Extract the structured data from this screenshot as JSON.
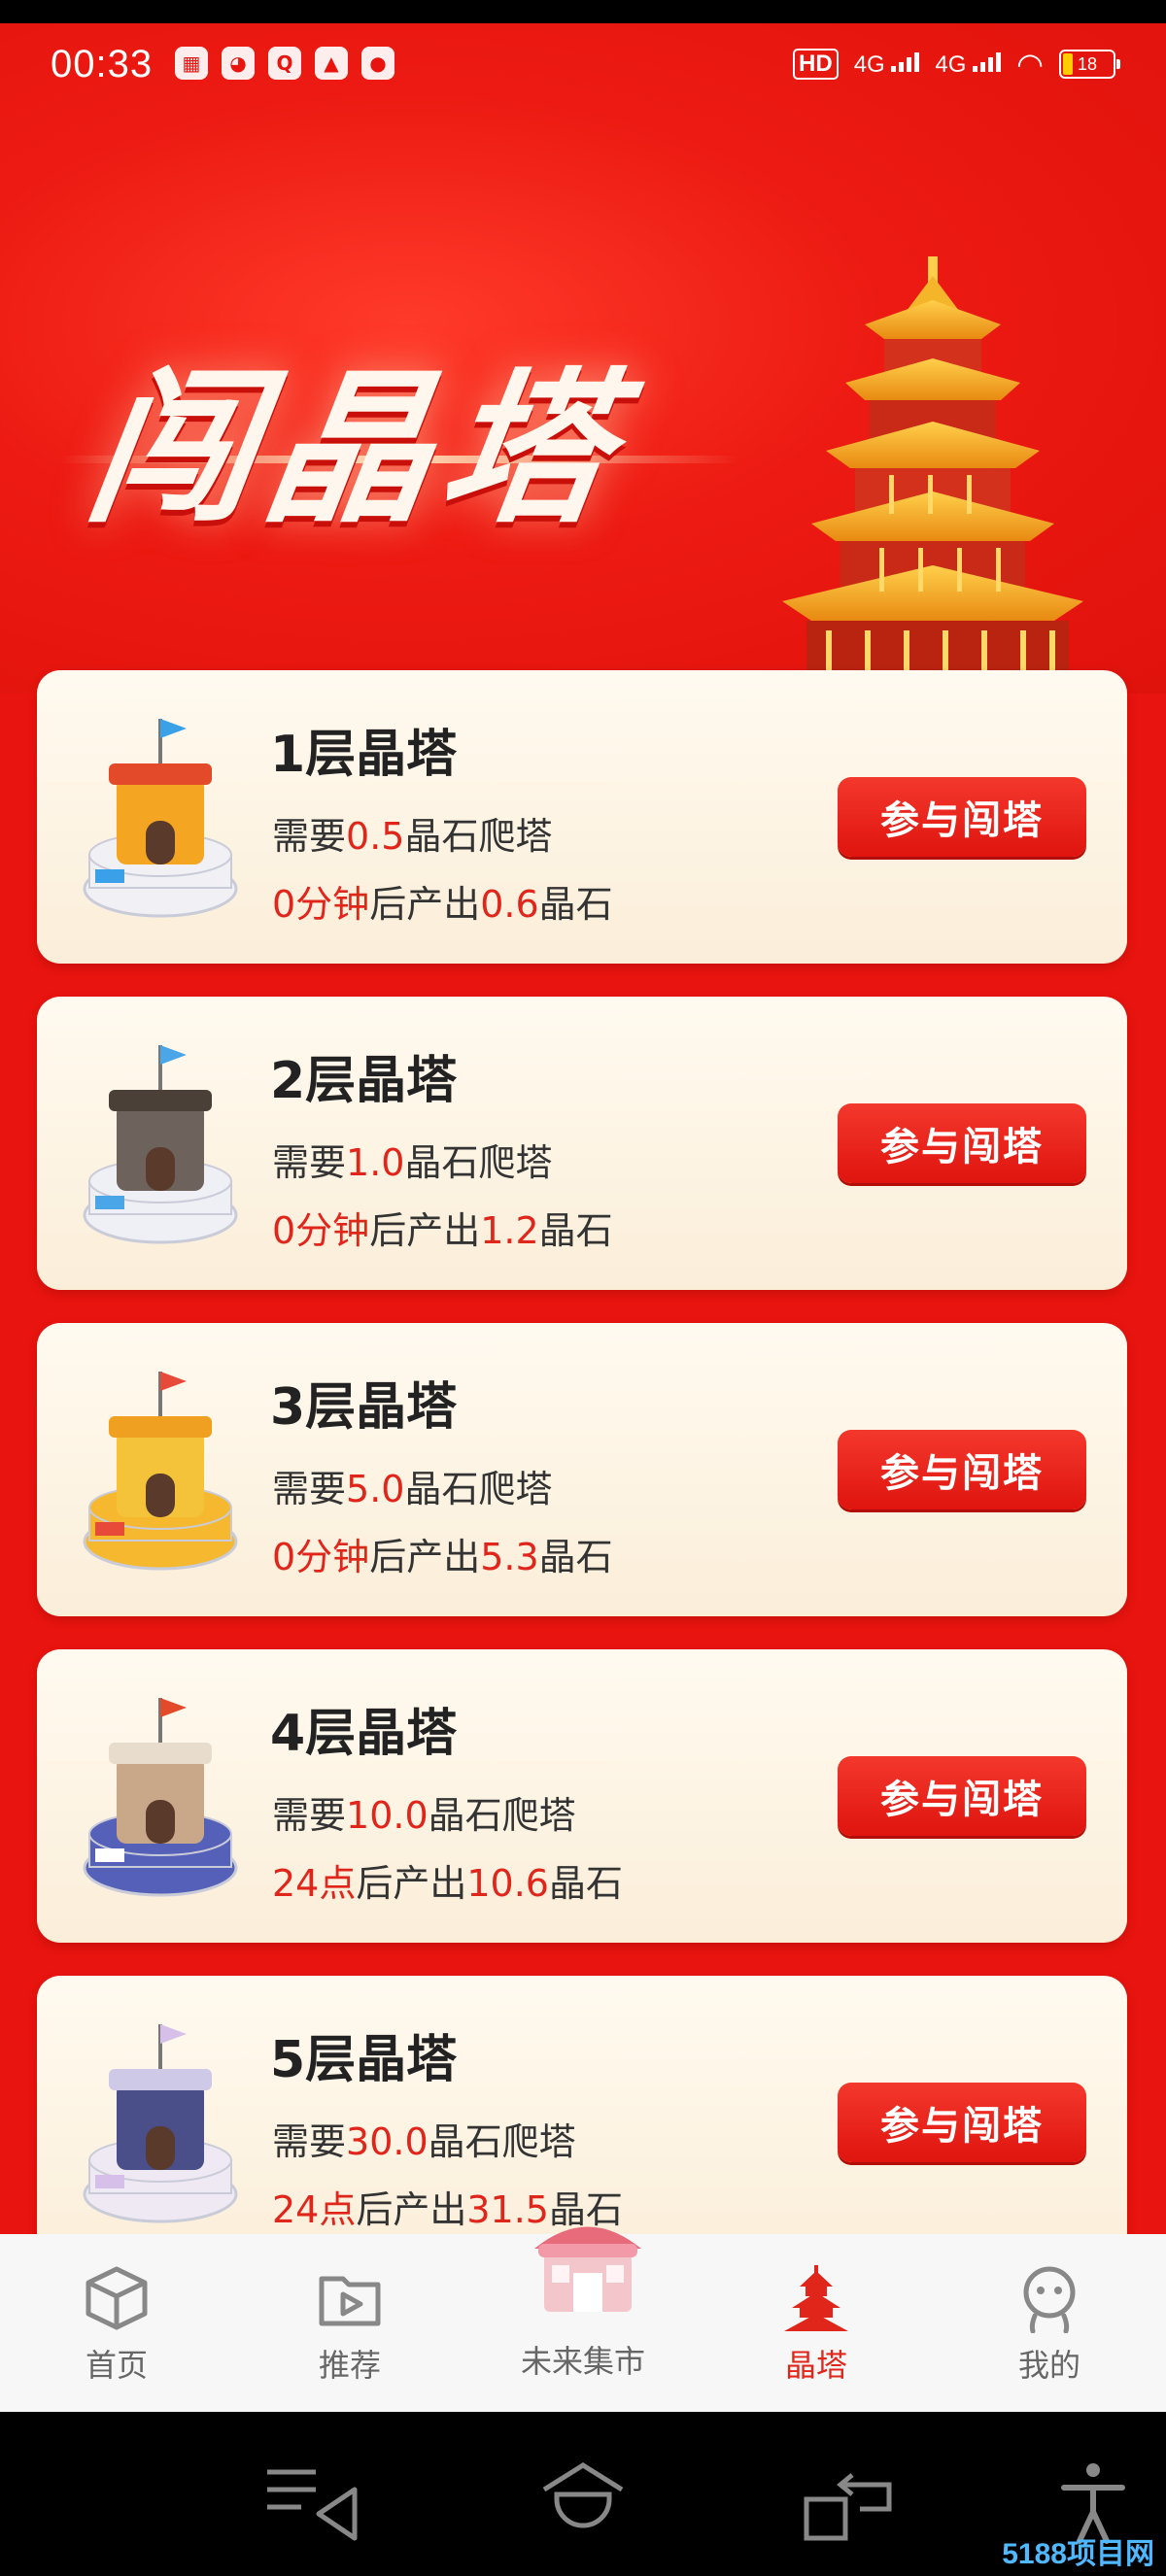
{
  "status_bar": {
    "time": "00:33",
    "hd_label": "HD",
    "network_1": "4G",
    "network_2": "4G",
    "battery": "18"
  },
  "hero": {
    "title": "闯晶塔"
  },
  "towers": [
    {
      "title": "1层晶塔",
      "need_prefix": "需要",
      "need_value": "0.5",
      "need_suffix": "晶石爬塔",
      "time_value": "0分钟",
      "output_prefix": "后产出",
      "output_value": "0.6",
      "output_suffix": "晶石",
      "button": "参与闯塔",
      "icon": "castle-orange-icon"
    },
    {
      "title": "2层晶塔",
      "need_prefix": "需要",
      "need_value": "1.0",
      "need_suffix": "晶石爬塔",
      "time_value": "0分钟",
      "output_prefix": "后产出",
      "output_value": "1.2",
      "output_suffix": "晶石",
      "button": "参与闯塔",
      "icon": "castle-gray-icon"
    },
    {
      "title": "3层晶塔",
      "need_prefix": "需要",
      "need_value": "5.0",
      "need_suffix": "晶石爬塔",
      "time_value": "0分钟",
      "output_prefix": "后产出",
      "output_value": "5.3",
      "output_suffix": "晶石",
      "button": "参与闯塔",
      "icon": "castle-gold-icon"
    },
    {
      "title": "4层晶塔",
      "need_prefix": "需要",
      "need_value": "10.0",
      "need_suffix": "晶石爬塔",
      "time_value": "24点",
      "output_prefix": "后产出",
      "output_value": "10.6",
      "output_suffix": "晶石",
      "button": "参与闯塔",
      "icon": "castle-blue-icon"
    },
    {
      "title": "5层晶塔",
      "need_prefix": "需要",
      "need_value": "30.0",
      "need_suffix": "晶石爬塔",
      "time_value": "24点",
      "output_prefix": "后产出",
      "output_value": "31.5",
      "output_suffix": "晶石",
      "button": "参与闯塔",
      "icon": "castle-purple-icon"
    }
  ],
  "tabbar": {
    "home": "首页",
    "recommend": "推荐",
    "market": "未来集市",
    "tower": "晶塔",
    "mine": "我的"
  },
  "watermark": "5188项目网",
  "colors": {
    "background": "#e8140f",
    "accent": "#e0251b",
    "card": "#fdf4e3"
  }
}
